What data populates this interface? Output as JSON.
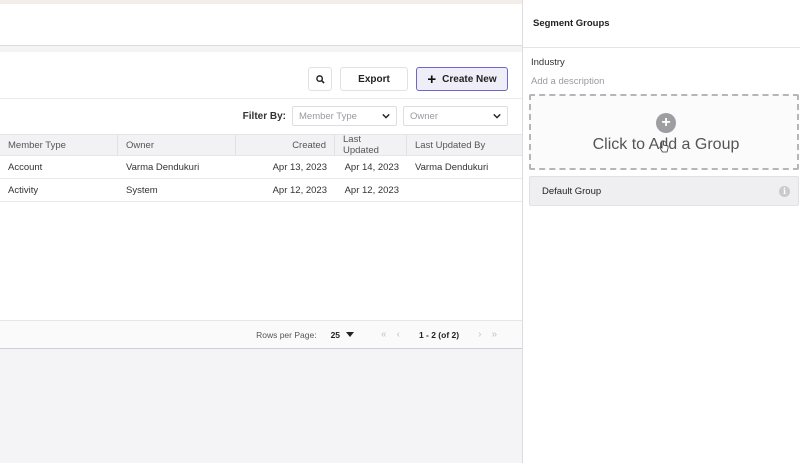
{
  "toolbar": {
    "export_label": "Export",
    "create_label": "Create New",
    "search_icon": "search-icon",
    "plus_icon": "plus-icon"
  },
  "filters": {
    "label": "Filter By:",
    "member_type_placeholder": "Member Type",
    "owner_placeholder": "Owner"
  },
  "table": {
    "columns": [
      "Member Type",
      "Owner",
      "Created",
      "Last Updated",
      "Last Updated By"
    ],
    "rows": [
      [
        "Account",
        "Varma Dendukuri",
        "Apr 13, 2023",
        "Apr 14, 2023",
        "Varma Dendukuri"
      ],
      [
        "Activity",
        "System",
        "Apr 12, 2023",
        "Apr 12, 2023",
        ""
      ]
    ]
  },
  "pagination": {
    "rows_per_page_label": "Rows per Page:",
    "rows_per_page": "25",
    "range": "1 - 2 (of 2)"
  },
  "side_panel": {
    "title": "Segment Groups",
    "name": "Industry",
    "description_placeholder": "Add a description",
    "add_group_label": "Click to Add a Group",
    "default_group_label": "Default Group"
  },
  "colors": {
    "accent": "#6f67c8",
    "create_bg": "#efeef8"
  }
}
